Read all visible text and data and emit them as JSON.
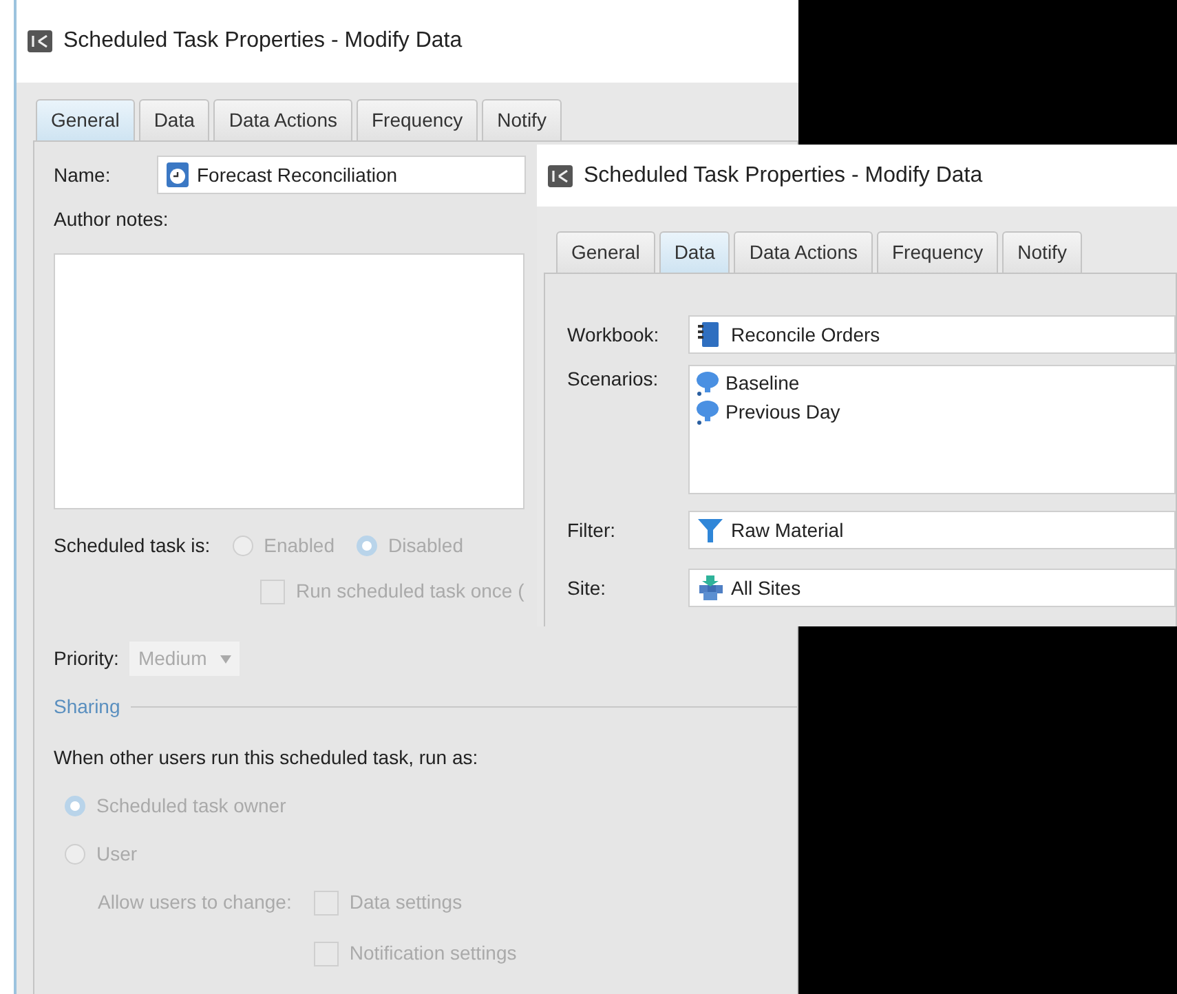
{
  "windows": [
    {
      "title": "Scheduled Task Properties - Modify Data",
      "tabs": [
        {
          "label": "General",
          "selected": true
        },
        {
          "label": "Data",
          "selected": false
        },
        {
          "label": "Data Actions",
          "selected": false
        },
        {
          "label": "Frequency",
          "selected": false
        },
        {
          "label": "Notify",
          "selected": false
        }
      ],
      "name": {
        "label": "Name:",
        "value": "Forecast Reconciliation"
      },
      "author_notes": {
        "label": "Author notes:"
      },
      "schedule": {
        "label": "Scheduled task is:",
        "options": [
          {
            "label": "Enabled",
            "selected": false,
            "disabled": true
          },
          {
            "label": "Disabled",
            "selected": true,
            "disabled": true
          }
        ],
        "run_once": {
          "label": "Run scheduled task once (",
          "checked": false,
          "disabled": true
        }
      },
      "priority": {
        "label": "Priority:",
        "value": "Medium",
        "disabled": true
      },
      "sharing": {
        "heading": "Sharing",
        "prompt": "When other users run this scheduled task, run as:",
        "run_as": [
          {
            "label": "Scheduled task owner",
            "selected": true,
            "disabled": true
          },
          {
            "label": "User",
            "selected": false,
            "disabled": true
          }
        ],
        "allow_label": "Allow users to change:",
        "allow_options": [
          {
            "label": "Data settings",
            "checked": false,
            "disabled": true
          },
          {
            "label": "Notification settings",
            "checked": false,
            "disabled": true
          }
        ]
      }
    },
    {
      "title": "Scheduled Task Properties - Modify Data",
      "tabs": [
        {
          "label": "General",
          "selected": false
        },
        {
          "label": "Data",
          "selected": true
        },
        {
          "label": "Data Actions",
          "selected": false
        },
        {
          "label": "Frequency",
          "selected": false
        },
        {
          "label": "Notify",
          "selected": false
        }
      ],
      "workbook": {
        "label": "Workbook:",
        "value": "Reconcile Orders"
      },
      "scenarios": {
        "label": "Scenarios:",
        "items": [
          "Baseline",
          "Previous Day"
        ]
      },
      "filter": {
        "label": "Filter:",
        "value": "Raw Material"
      },
      "site": {
        "label": "Site:",
        "value": "All Sites"
      }
    }
  ]
}
